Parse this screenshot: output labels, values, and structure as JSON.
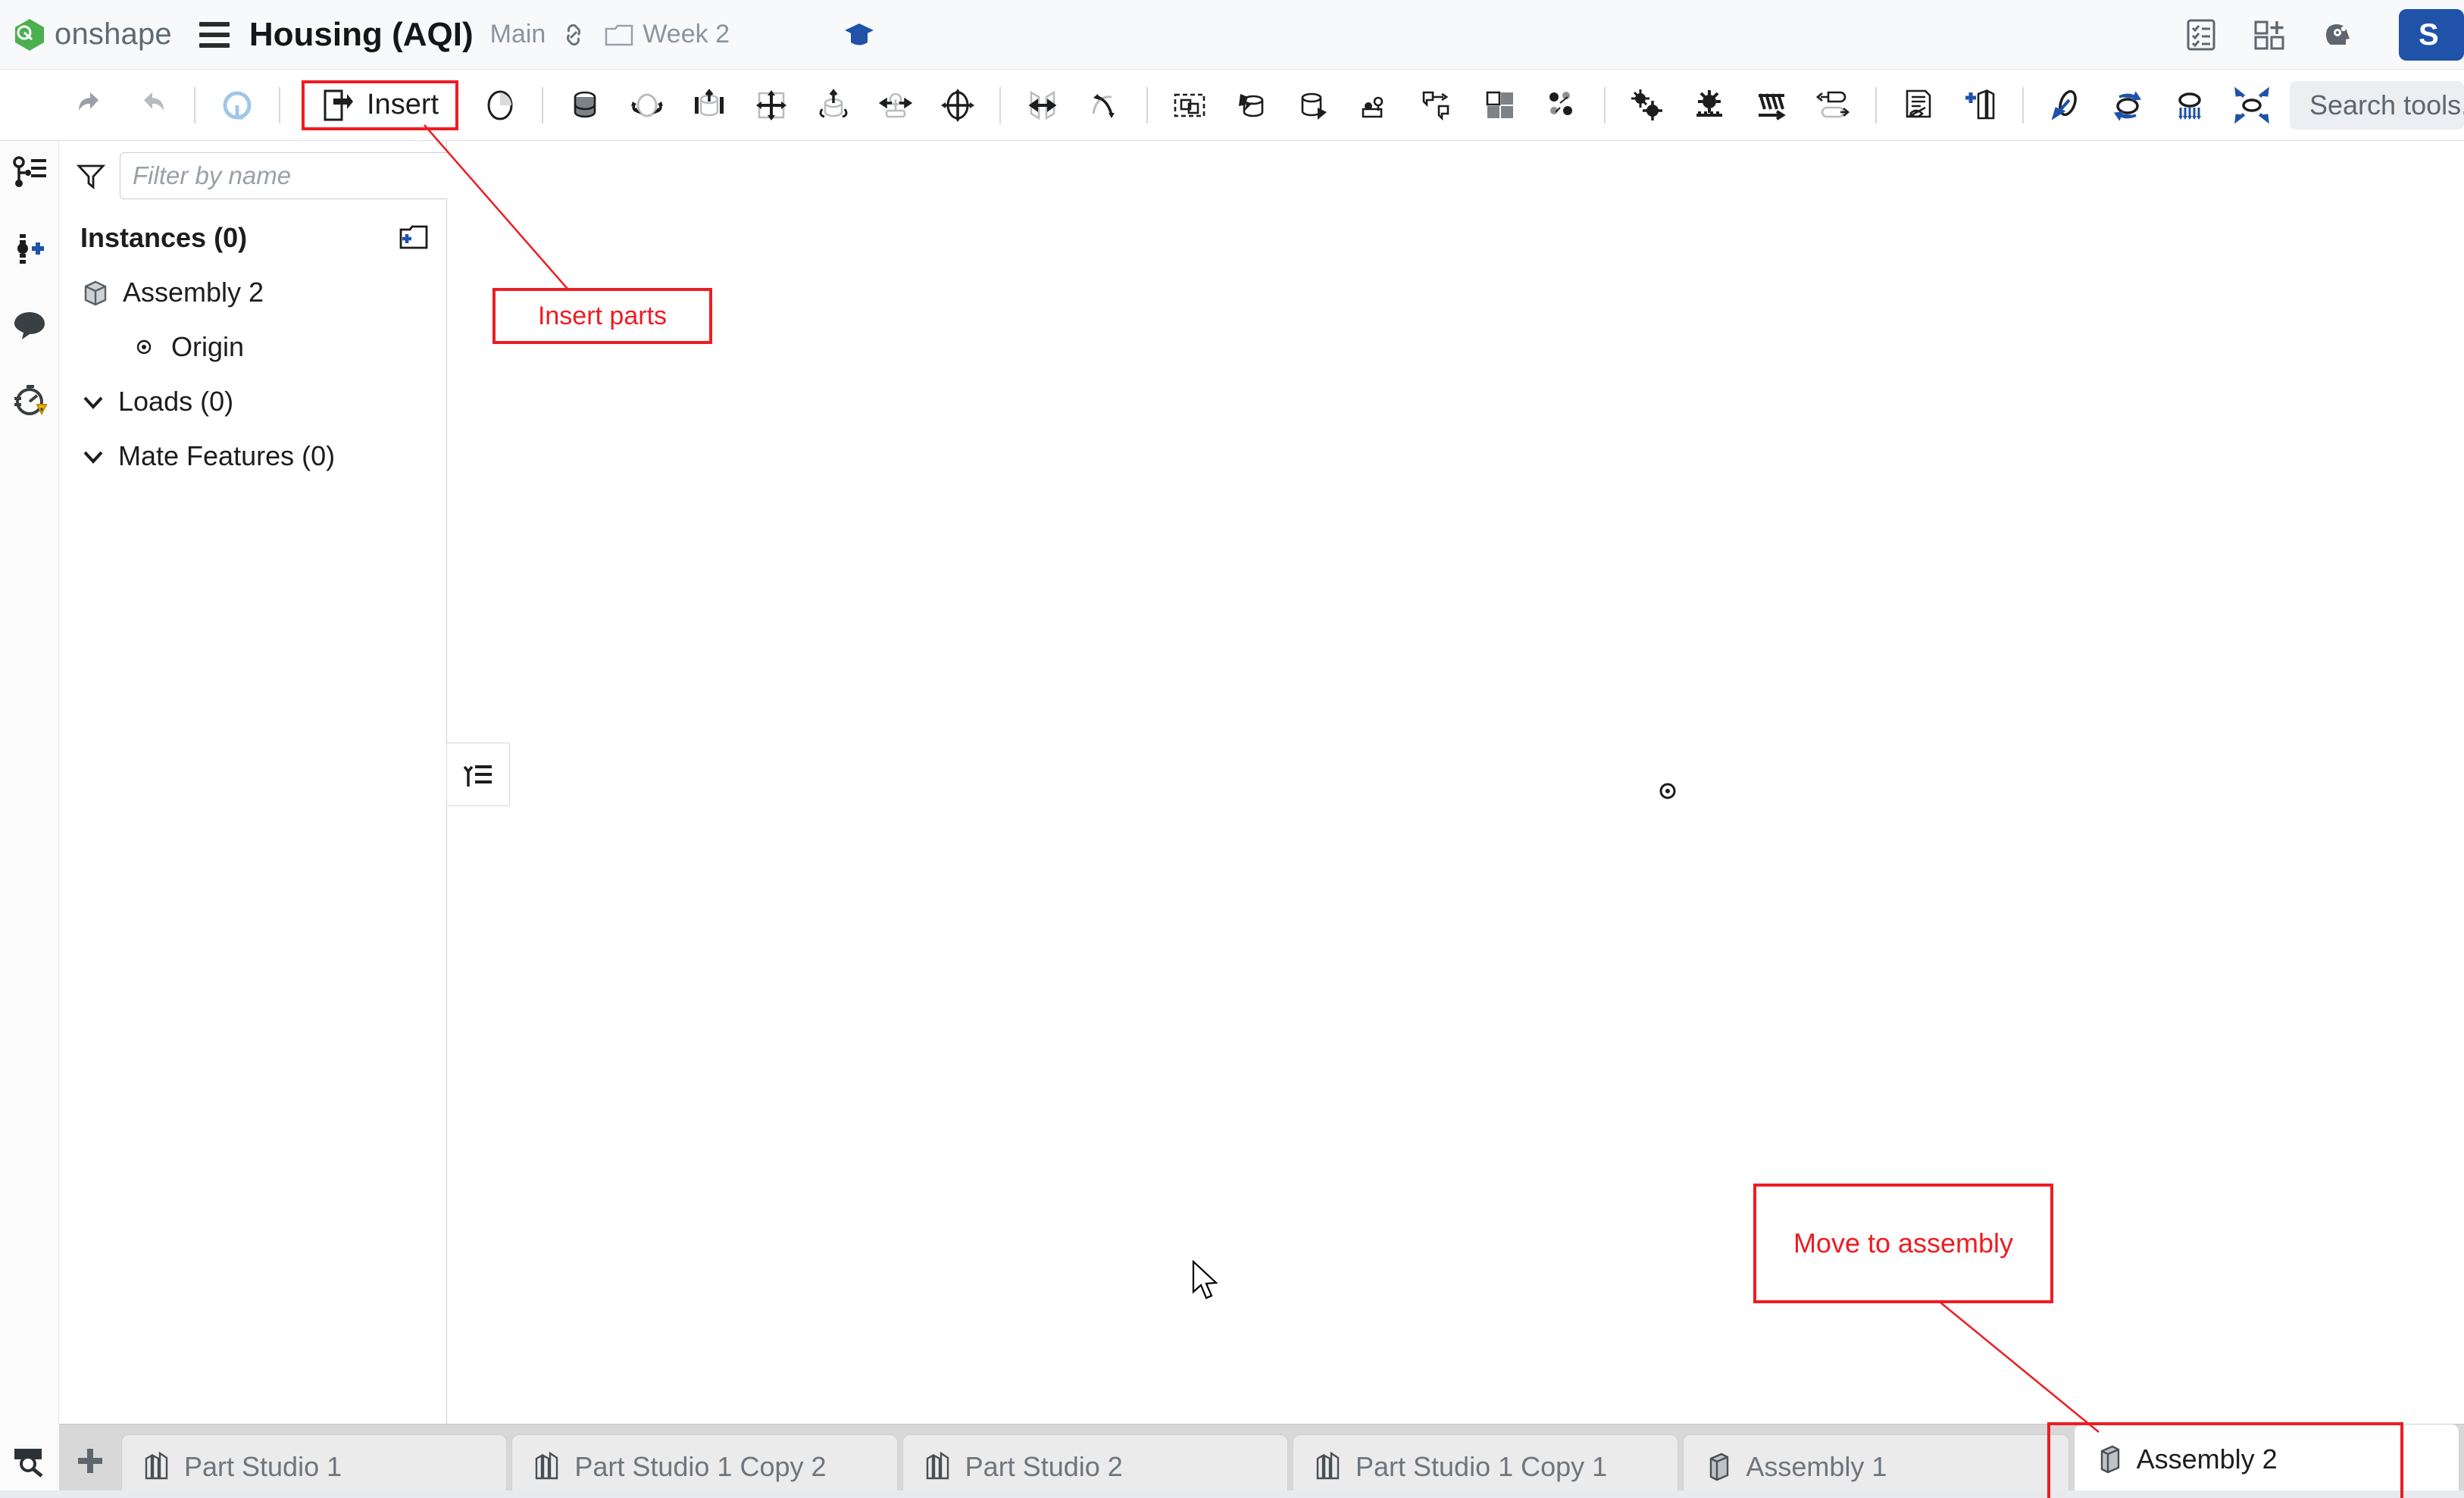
{
  "header": {
    "brand": "onshape",
    "logo_icon": "onshape-logo-icon",
    "menu_icon": "hamburger-menu-icon",
    "doc_title": "Housing (AQI)",
    "branch": "Main",
    "link_icon": "link-icon",
    "folder_icon": "folder-icon",
    "folder_name": "Week 2",
    "learning_icon": "graduation-cap-icon",
    "right_icons": [
      {
        "name": "checklist-icon",
        "label": "Tasks"
      },
      {
        "name": "add-panel-icon",
        "label": "Apps"
      },
      {
        "name": "ai-brain-icon",
        "label": "AI Advisor"
      }
    ],
    "share_label": "S"
  },
  "toolbar": {
    "undo_label": "Undo",
    "redo_label": "Redo",
    "rebuild_label": "Rebuild",
    "insert_label": "Insert",
    "search_placeholder": "Search tools...",
    "tools": [
      {
        "name": "undo-icon",
        "label": "Undo"
      },
      {
        "name": "redo-icon",
        "label": "Redo"
      },
      {
        "name": "rebuild-icon",
        "label": "Rebuild"
      },
      {
        "name": "mate-connector-icon",
        "label": "Mate connector"
      },
      {
        "name": "fastened-mate-icon",
        "label": "Fastened mate"
      },
      {
        "name": "revolute-mate-icon",
        "label": "Revolute mate"
      },
      {
        "name": "slider-mate-icon",
        "label": "Slider mate"
      },
      {
        "name": "planar-mate-icon",
        "label": "Planar mate"
      },
      {
        "name": "cylindrical-mate-icon",
        "label": "Cylindrical mate"
      },
      {
        "name": "pin-slot-mate-icon",
        "label": "Pin slot mate"
      },
      {
        "name": "ball-mate-icon",
        "label": "Ball mate"
      },
      {
        "name": "parallel-mate-icon",
        "label": "Parallel mate"
      },
      {
        "name": "tangent-mate-icon",
        "label": "Tangent mate"
      },
      {
        "name": "group-icon",
        "label": "Group"
      },
      {
        "name": "fastener-icon",
        "label": "Fastener"
      },
      {
        "name": "replace-instance-icon",
        "label": "Replace instance"
      },
      {
        "name": "insert-fastener-icon",
        "label": "Insert fastener"
      },
      {
        "name": "transform-icon",
        "label": "Transform"
      },
      {
        "name": "pattern-icon",
        "label": "Pattern"
      },
      {
        "name": "explode-icon",
        "label": "Explode"
      },
      {
        "name": "gear-mate-icon",
        "label": "Gear mate"
      },
      {
        "name": "rack-pinion-icon",
        "label": "Rack and pinion"
      },
      {
        "name": "spring-icon",
        "label": "Spring"
      },
      {
        "name": "linear-relation-icon",
        "label": "Linear relation"
      },
      {
        "name": "bom-hide-icon",
        "label": "Hide/show"
      },
      {
        "name": "add-part-icon",
        "label": "Add part"
      },
      {
        "name": "load-moment-icon",
        "label": "Moment load"
      },
      {
        "name": "load-torque-icon",
        "label": "Torque load"
      },
      {
        "name": "load-pressure-icon",
        "label": "Pressure load"
      },
      {
        "name": "load-constraint-icon",
        "label": "Constraint"
      },
      {
        "name": "load-force-icon",
        "label": "Force load"
      }
    ]
  },
  "rail": {
    "items": [
      {
        "name": "version-graph-icon",
        "label": "Versions and history"
      },
      {
        "name": "add-version-icon",
        "label": "Create version"
      },
      {
        "name": "comments-icon",
        "label": "Comments"
      },
      {
        "name": "performance-warning-icon",
        "label": "Performance"
      }
    ],
    "inspect_icon": "inspect-magnifier-icon"
  },
  "panel": {
    "filter_placeholder": "Filter by name",
    "funnel_icon": "filter-funnel-icon",
    "list_icon": "list-view-icon",
    "new_folder_icon": "new-folder-icon",
    "instances_label": "Instances (0)",
    "tree": [
      {
        "label": "Assembly 2",
        "icon": "assembly-icon",
        "indent": false,
        "chevron": false
      },
      {
        "label": "Origin",
        "icon": "origin-icon",
        "indent": true,
        "chevron": false
      }
    ],
    "loads_label": "Loads (0)",
    "mate_features_label": "Mate Features (0)"
  },
  "canvas": {
    "origin_marker": "origin-point-icon",
    "panel_toggle_icon": "collapse-list-icon",
    "cursor_icon": "mouse-cursor-icon"
  },
  "annotations": [
    {
      "id": "insert",
      "text": "Insert parts",
      "color": "#ee1c23"
    },
    {
      "id": "move",
      "text": "Move to assembly",
      "color": "#ee1c23"
    }
  ],
  "tabs": {
    "add_label": "+",
    "items": [
      {
        "label": "Part Studio 1",
        "icon": "part-studio-icon",
        "active": false
      },
      {
        "label": "Part Studio 1 Copy 2",
        "icon": "part-studio-icon",
        "active": false
      },
      {
        "label": "Part Studio 2",
        "icon": "part-studio-icon",
        "active": false
      },
      {
        "label": "Part Studio 1 Copy 1",
        "icon": "part-studio-icon",
        "active": false
      },
      {
        "label": "Assembly 1",
        "icon": "assembly-tab-icon",
        "active": false
      },
      {
        "label": "Assembly 2",
        "icon": "assembly-tab-icon",
        "active": true
      }
    ]
  },
  "colors": {
    "accent": "#1f52a8",
    "annotation": "#ee1c23",
    "brand_green": "#4caf50",
    "header_bg": "#f7f9fb",
    "tabbar_bg": "#d8d8d8"
  }
}
